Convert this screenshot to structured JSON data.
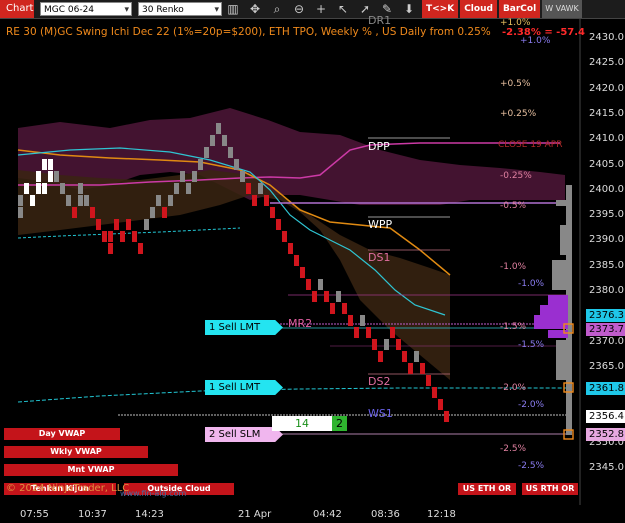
{
  "toolbar": {
    "chart_tab": "Chart",
    "instrument": "MGC 06-24",
    "period": "30 Renko",
    "icons": [
      "bar-chart-icon",
      "crosshair-icon",
      "magnify-icon",
      "zoom-out-icon",
      "plus-icon",
      "cursor-icon",
      "arrow-icon",
      "draw-icon",
      "down-arrow-icon"
    ],
    "tk_button": "T<>K",
    "cloud_button": "Cloud",
    "barcol_button": "BarCol",
    "wvawk_button": "W VAWK"
  },
  "title": "RE 30 (M)GC Swing Ichi Dec 22 (1%=20p=$200), ETH TPO, Weekly % , US Daily from 0.25%",
  "header_change": "-2.38% = -57.4",
  "y_axis": [
    "2430.0",
    "2425.0",
    "2420.0",
    "2415.0",
    "2410.0",
    "2405.0",
    "2400.0",
    "2395.0",
    "2390.0",
    "2385.0",
    "2380.0",
    "2375.0",
    "2370.0",
    "2365.0",
    "2360.0",
    "2355.0",
    "2350.0",
    "2345.0"
  ],
  "x_axis": [
    "07:55",
    "10:37",
    "14:23",
    "21 Apr",
    "04:42",
    "08:36",
    "12:18"
  ],
  "price_boxes": [
    {
      "value": "2376.3",
      "color": "#1fc7e8"
    },
    {
      "value": "2373.7",
      "color": "#c05ccc"
    },
    {
      "value": "2361.8",
      "color": "#1fc7e8"
    },
    {
      "value": "2356.4",
      "color": "#ffffff"
    },
    {
      "value": "2352.8",
      "color": "#e7a8e0"
    }
  ],
  "levels": {
    "dpp": "DPP",
    "wpp": "WPP",
    "ds1": "DS1",
    "mr2": "MR2",
    "ds2": "DS2",
    "ws1": "WS1",
    "dr1": "DR1",
    "close_label": "CLOSE 19 APR"
  },
  "weekly_pcts": [
    "+1.0%",
    "+0.5%",
    "+0.25%",
    "-0.25%",
    "-0.5%",
    "-1.0%",
    "-1.5%",
    "-2.0%",
    "-2.5%"
  ],
  "daily_pcts": [
    "+1.0%",
    "-1.0%",
    "-1.5%",
    "-2.0%",
    "-2.5%"
  ],
  "order_tags": [
    {
      "label": "1 Sell LMT",
      "color": "#24e4f0"
    },
    {
      "label": "1 Sell LMT",
      "color": "#24e4f0"
    },
    {
      "label": "2 Sell SLM",
      "color": "#f0b6ee"
    }
  ],
  "counter": {
    "left": "14",
    "right": "2"
  },
  "buttons": {
    "day_vwap": "Day VWAP",
    "wkly_vwap": "Wkly VWAP",
    "mnt_vwap": "Mnt VWAP",
    "tenkan_kijun": "Tenkan Kijun",
    "outside_cloud": "Outside Cloud",
    "us_eth_or": "US ETH OR",
    "us_rth_or": "US RTH OR"
  },
  "copyright": "© 2024 NinjaTrader, LLC",
  "watermark": "www.fin-alg.com"
}
